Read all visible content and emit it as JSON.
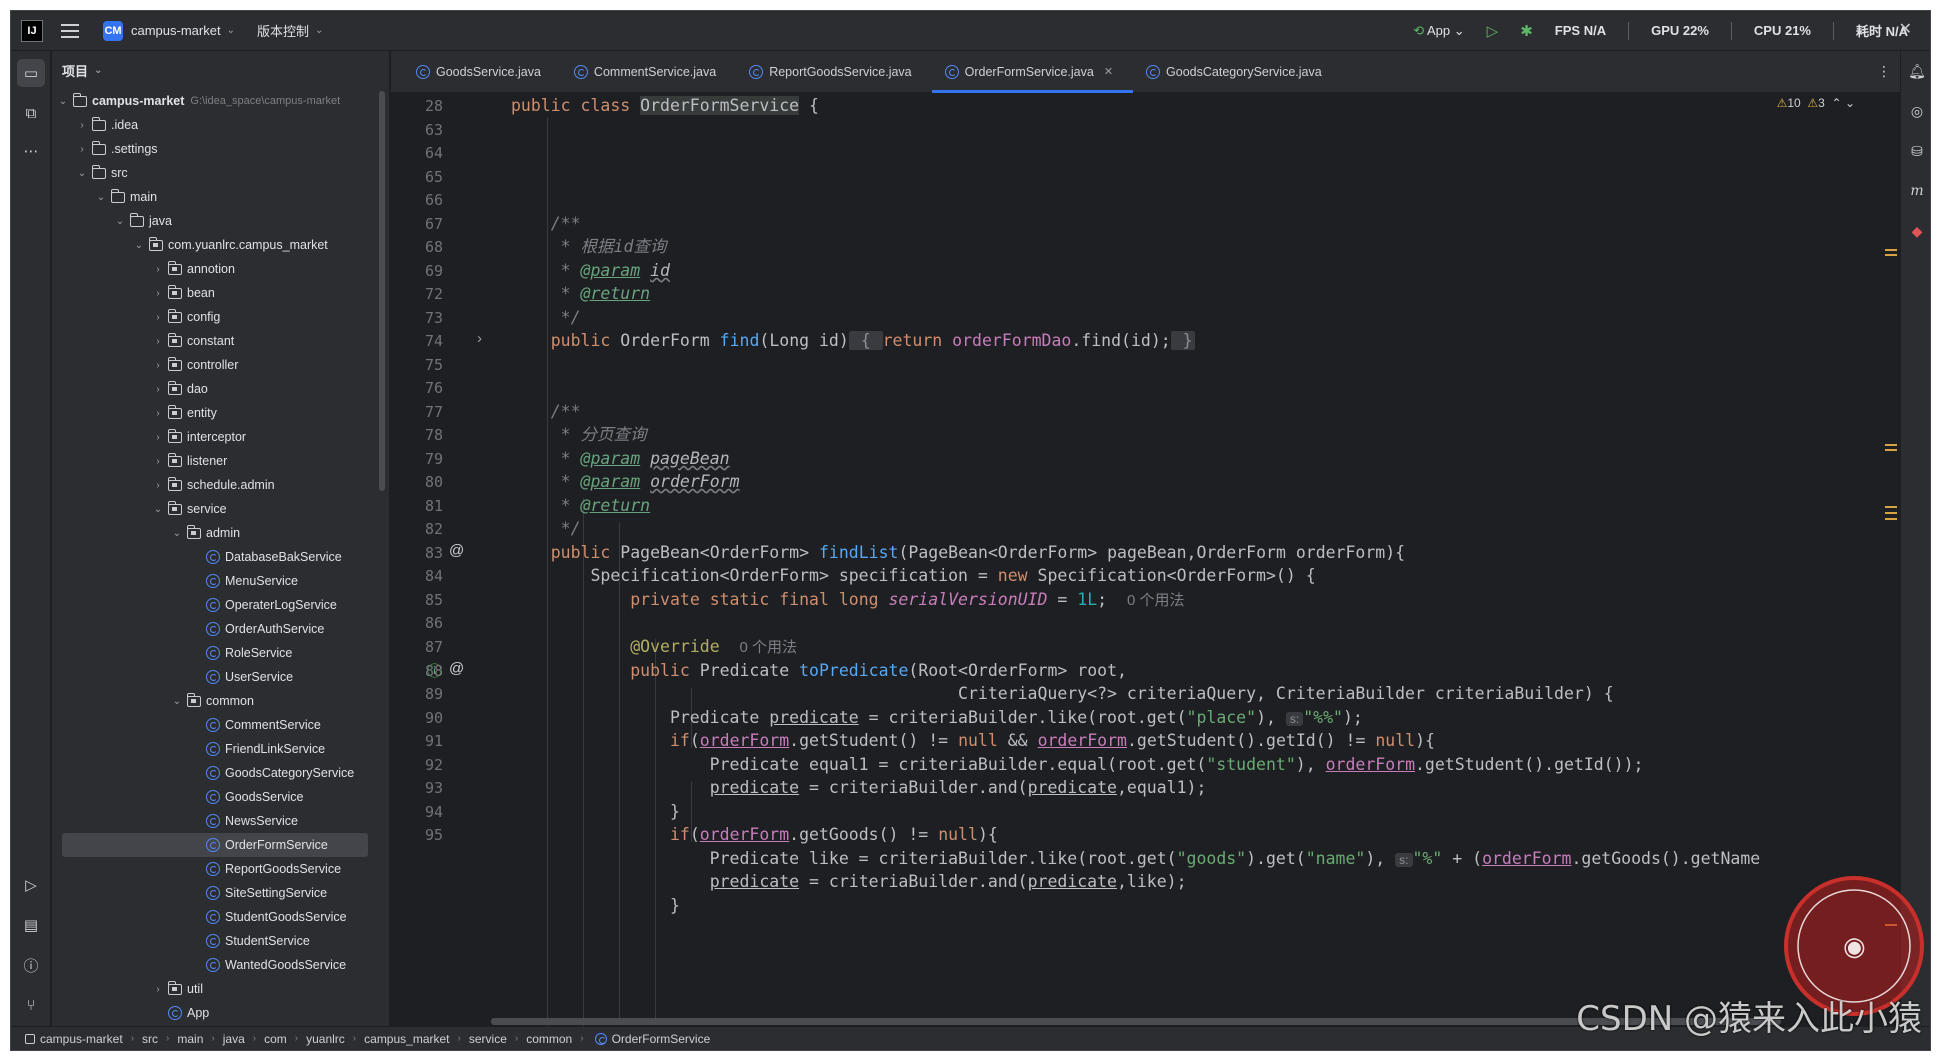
{
  "titlebar": {
    "project_badge": "CM",
    "project_name": "campus-market",
    "vcs_label": "版本控制",
    "run_config": "App",
    "fps": "FPS N/A",
    "gpu": "GPU 22%",
    "cpu": "CPU 21%",
    "time": "耗时 N/A"
  },
  "project_panel": {
    "header": "项目",
    "root_name": "campus-market",
    "root_path": "G:\\idea_space\\campus-market",
    "tree": [
      {
        "label": ".idea",
        "depth": 1,
        "type": "folder",
        "expanded": false
      },
      {
        "label": ".settings",
        "depth": 1,
        "type": "folder",
        "expanded": false
      },
      {
        "label": "src",
        "depth": 1,
        "type": "folder",
        "expanded": true
      },
      {
        "label": "main",
        "depth": 2,
        "type": "folder",
        "expanded": true
      },
      {
        "label": "java",
        "depth": 3,
        "type": "folder",
        "expanded": true
      },
      {
        "label": "com.yuanlrc.campus_market",
        "depth": 4,
        "type": "package",
        "expanded": true
      },
      {
        "label": "annotion",
        "depth": 5,
        "type": "package",
        "expanded": false
      },
      {
        "label": "bean",
        "depth": 5,
        "type": "package",
        "expanded": false
      },
      {
        "label": "config",
        "depth": 5,
        "type": "package",
        "expanded": false
      },
      {
        "label": "constant",
        "depth": 5,
        "type": "package",
        "expanded": false
      },
      {
        "label": "controller",
        "depth": 5,
        "type": "package",
        "expanded": false
      },
      {
        "label": "dao",
        "depth": 5,
        "type": "package",
        "expanded": false
      },
      {
        "label": "entity",
        "depth": 5,
        "type": "package",
        "expanded": false
      },
      {
        "label": "interceptor",
        "depth": 5,
        "type": "package",
        "expanded": false
      },
      {
        "label": "listener",
        "depth": 5,
        "type": "package",
        "expanded": false
      },
      {
        "label": "schedule.admin",
        "depth": 5,
        "type": "package",
        "expanded": false
      },
      {
        "label": "service",
        "depth": 5,
        "type": "package",
        "expanded": true
      },
      {
        "label": "admin",
        "depth": 6,
        "type": "package",
        "expanded": true
      },
      {
        "label": "DatabaseBakService",
        "depth": 7,
        "type": "class"
      },
      {
        "label": "MenuService",
        "depth": 7,
        "type": "class"
      },
      {
        "label": "OperaterLogService",
        "depth": 7,
        "type": "class"
      },
      {
        "label": "OrderAuthService",
        "depth": 7,
        "type": "class"
      },
      {
        "label": "RoleService",
        "depth": 7,
        "type": "class"
      },
      {
        "label": "UserService",
        "depth": 7,
        "type": "class"
      },
      {
        "label": "common",
        "depth": 6,
        "type": "package",
        "expanded": true
      },
      {
        "label": "CommentService",
        "depth": 7,
        "type": "class"
      },
      {
        "label": "FriendLinkService",
        "depth": 7,
        "type": "class"
      },
      {
        "label": "GoodsCategoryService",
        "depth": 7,
        "type": "class"
      },
      {
        "label": "GoodsService",
        "depth": 7,
        "type": "class"
      },
      {
        "label": "NewsService",
        "depth": 7,
        "type": "class"
      },
      {
        "label": "OrderFormService",
        "depth": 7,
        "type": "class",
        "selected": true
      },
      {
        "label": "ReportGoodsService",
        "depth": 7,
        "type": "class"
      },
      {
        "label": "SiteSettingService",
        "depth": 7,
        "type": "class"
      },
      {
        "label": "StudentGoodsService",
        "depth": 7,
        "type": "class"
      },
      {
        "label": "StudentService",
        "depth": 7,
        "type": "class"
      },
      {
        "label": "WantedGoodsService",
        "depth": 7,
        "type": "class"
      },
      {
        "label": "util",
        "depth": 5,
        "type": "package",
        "expanded": false
      },
      {
        "label": "App",
        "depth": 5,
        "type": "class"
      }
    ]
  },
  "tabs": [
    {
      "label": "GoodsService.java",
      "active": false
    },
    {
      "label": "CommentService.java",
      "active": false
    },
    {
      "label": "ReportGoodsService.java",
      "active": false
    },
    {
      "label": "OrderFormService.java",
      "active": true
    },
    {
      "label": "GoodsCategoryService.java",
      "active": false
    }
  ],
  "editor": {
    "inspections": {
      "warnings": "10",
      "weak_warnings": "3"
    },
    "line_numbers": [
      "28",
      "63",
      "64",
      "65",
      "66",
      "67",
      "68",
      "69",
      "72",
      "73",
      "74",
      "75",
      "76",
      "77",
      "78",
      "79",
      "80",
      "81",
      "82",
      "83",
      "84",
      "85",
      "86",
      "87",
      "88",
      "89",
      "90",
      "91",
      "92",
      "93",
      "94",
      "95"
    ],
    "hints": {
      "unused_1": "0 个用法",
      "unused_2": "0 个用法",
      "inlay_s": "s:"
    },
    "comments": {
      "find_by_id": "* 根据id查询",
      "paged_query": "* 分页查询"
    }
  },
  "statusbar": {
    "breadcrumbs": [
      "campus-market",
      "src",
      "main",
      "java",
      "com",
      "yuanlrc",
      "campus_market",
      "service",
      "common",
      "OrderFormService"
    ]
  },
  "watermark": {
    "csdn": "CSDN @猿来入此小猿"
  },
  "colors": {
    "accent": "#3574f0",
    "keyword": "#cf8e6d",
    "function": "#56a8f5",
    "string": "#6aab73",
    "field": "#c77dbb",
    "javadoc_tag": "#67a37c"
  }
}
